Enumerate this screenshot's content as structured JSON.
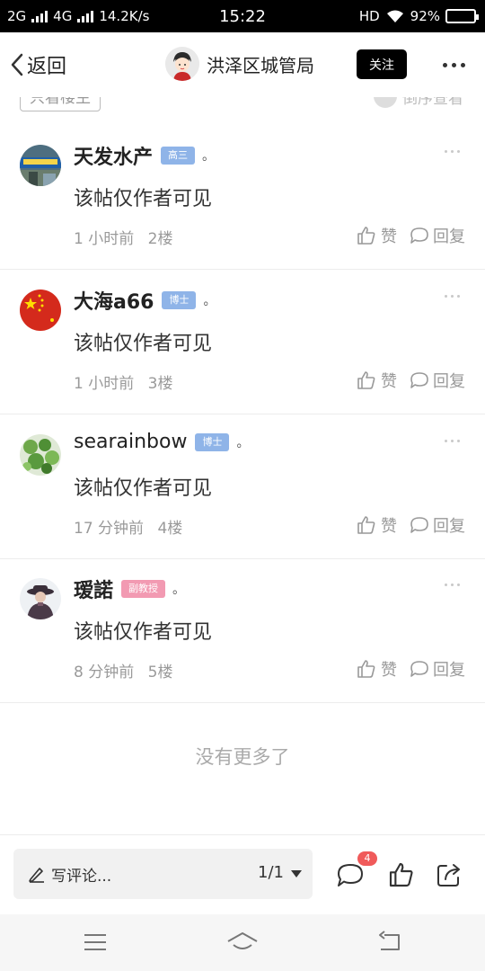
{
  "status_bar": {
    "network1": "2G",
    "network2": "4G",
    "speed": "14.2K/s",
    "time": "15:22",
    "hd": "HD",
    "battery": "92%",
    "battery_level": 0.92
  },
  "header": {
    "back_label": "返回",
    "account_name": "洪泽区城管局",
    "follow_label": "关注"
  },
  "filter": {
    "only_op_label": "只看楼主",
    "reverse_label": "倒序查看"
  },
  "posts": [
    {
      "username": "天发水产",
      "badge": "高三",
      "badge_color": "#8fb4e8",
      "period": "。",
      "content": "该帖仅作者可见",
      "time": "1 小时前",
      "floor": "2楼",
      "like_label": "赞",
      "reply_label": "回复"
    },
    {
      "username": "大海a66",
      "badge": "博士",
      "badge_color": "#8fb4e8",
      "period": "。",
      "content": "该帖仅作者可见",
      "time": "1 小时前",
      "floor": "3楼",
      "like_label": "赞",
      "reply_label": "回复"
    },
    {
      "username": "searainbow",
      "badge": "博士",
      "badge_color": "#8fb4e8",
      "period": "。",
      "content": "该帖仅作者可见",
      "time": "17 分钟前",
      "floor": "4楼",
      "like_label": "赞",
      "reply_label": "回复"
    },
    {
      "username": "瑷諾",
      "badge": "副教授",
      "badge_color": "#f29ab2",
      "period": "。",
      "content": "该帖仅作者可见",
      "time": "8 分钟前",
      "floor": "5楼",
      "like_label": "赞",
      "reply_label": "回复"
    }
  ],
  "no_more_label": "没有更多了",
  "bottom_bar": {
    "comment_placeholder": "写评论...",
    "page_indicator": "1/1",
    "comment_count": "4"
  },
  "icons": {
    "back": "chevron-left-icon",
    "more": "more-dots-icon",
    "like": "thumbs-up-icon",
    "reply": "comment-bubble-icon",
    "pen": "pen-icon",
    "share": "share-icon",
    "nav_menu": "menu-icon",
    "nav_home": "home-icon",
    "nav_back": "back-icon"
  }
}
